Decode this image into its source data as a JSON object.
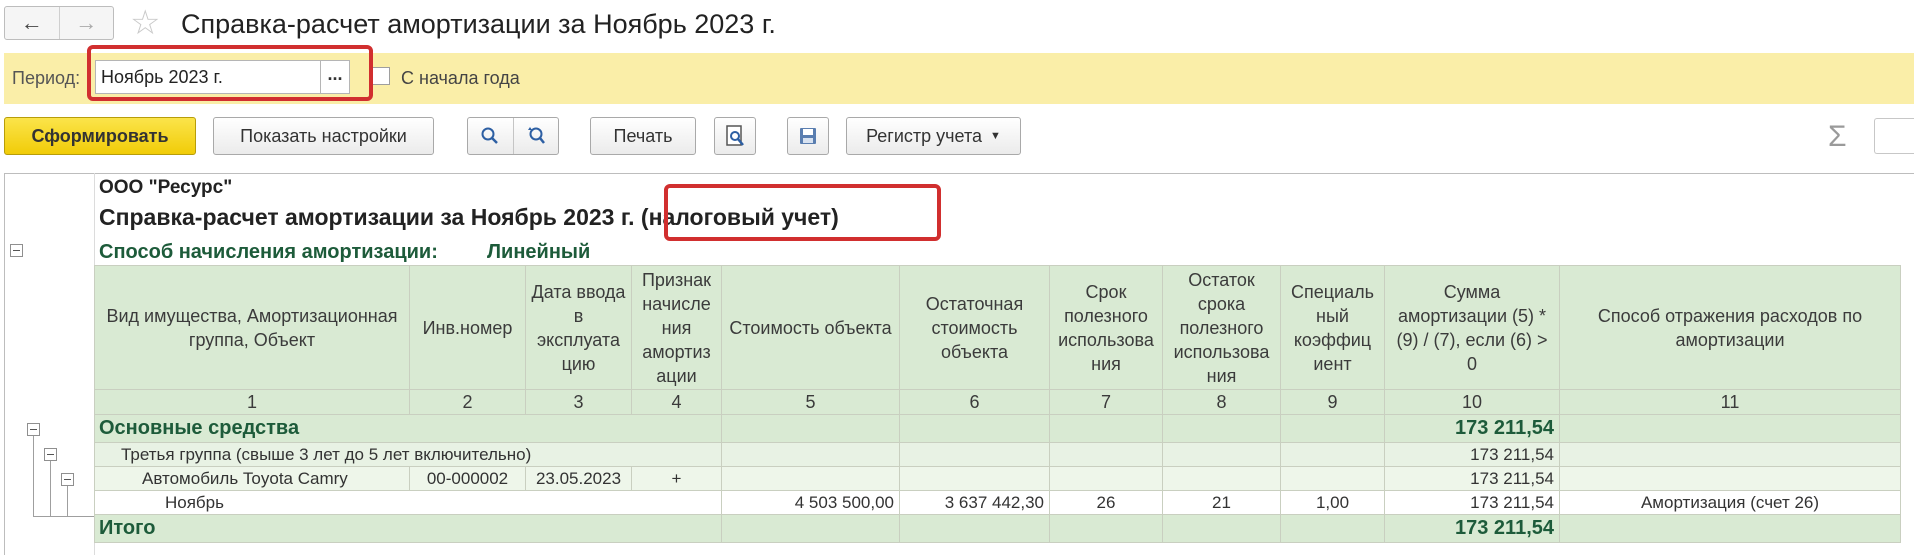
{
  "window": {
    "title": "Справка-расчет амортизации за Ноябрь 2023 г."
  },
  "nav": {
    "back_icon": "arrow-left-icon",
    "forward_icon": "arrow-right-icon",
    "favorite_icon": "star-icon"
  },
  "period": {
    "label": "Период:",
    "value": "Ноябрь 2023 г.",
    "select_btn": "...",
    "from_year_start_label": "С начала года",
    "from_year_start_checked": false
  },
  "toolbar": {
    "generate": "Сформировать",
    "show_settings": "Показать настройки",
    "print": "Печать",
    "register": "Регистр учета",
    "sigma": "Σ"
  },
  "report": {
    "company": "ООО \"Ресурс\"",
    "title": "Справка-расчет амортизации за Ноябрь 2023 г.",
    "title_suffix": "(налоговый учет)",
    "method_label": "Способ начисления амортизации:",
    "method_value": "Линейный",
    "headers": [
      "Вид имущества, Амортизационная группа, Объект",
      "Инв.номер",
      "Дата ввода в эксплуата цию",
      "Признак начисле ния амортиз ации",
      "Стоимость объекта",
      "Остаточная стоимость объекта",
      "Срок полезного использова ния",
      "Остаток срока полезного использова ния",
      "Специаль ный коэффиц иент",
      "Сумма амортизации (5) * (9) / (7), если (6) > 0",
      "Способ отражения расходов по амортизации"
    ],
    "col_numbers": [
      "1",
      "2",
      "3",
      "4",
      "5",
      "6",
      "7",
      "8",
      "9",
      "10",
      "11"
    ],
    "rows": {
      "group": {
        "name": "Основные средства",
        "amount": "173 211,54"
      },
      "subgroup": {
        "name": "Третья группа (свыше 3 лет до 5 лет включительно)",
        "amount": "173 211,54"
      },
      "object": {
        "name": "Автомобиль Toyota Camry",
        "inv": "00-000002",
        "date": "23.05.2023",
        "flag": "+",
        "amount": "173 211,54"
      },
      "month": {
        "name": "Ноябрь",
        "cost": "4 503 500,00",
        "residual": "3 637 442,30",
        "term": "26",
        "remaining": "21",
        "coef": "1,00",
        "amount": "173 211,54",
        "method": "Амортизация (счет 26)"
      },
      "total": {
        "name": "Итого",
        "amount": "173 211,54"
      }
    }
  }
}
